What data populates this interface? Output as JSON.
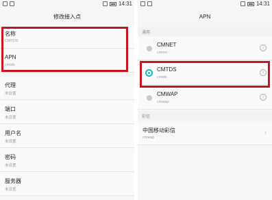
{
  "left": {
    "status_time": "14:31",
    "title": "修改接入点",
    "fields": [
      {
        "label": "名称",
        "value": "CMTDS"
      },
      {
        "label": "APN",
        "value": "cmtds"
      },
      {
        "label": "代理",
        "value": "未设置"
      },
      {
        "label": "端口",
        "value": "未设置"
      },
      {
        "label": "用户名",
        "value": "未设置"
      },
      {
        "label": "密码",
        "value": "未设置"
      },
      {
        "label": "服务器",
        "value": "未设置"
      }
    ]
  },
  "right": {
    "status_time": "14:31",
    "title": "APN",
    "section_general": "通用",
    "apns": [
      {
        "name": "CMNET",
        "apn": "cmnet",
        "selected": false
      },
      {
        "name": "CMTDS",
        "apn": "cmtds",
        "selected": true
      },
      {
        "name": "CMWAP",
        "apn": "cmwap",
        "selected": false
      }
    ],
    "section_mms": "彩信",
    "mms": {
      "name": "中国移动彩信",
      "apn": "cmwap"
    }
  },
  "colors": {
    "highlight": "#c4161f",
    "accent": "#21b8b0"
  }
}
